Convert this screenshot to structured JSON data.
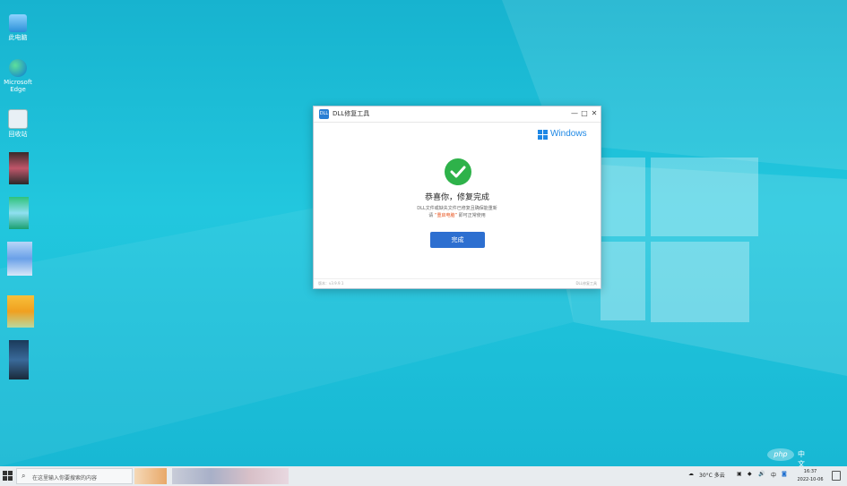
{
  "desktop": {
    "icons": [
      {
        "label": "此电脑",
        "icon": "computer-icon"
      },
      {
        "label": "Microsoft Edge",
        "icon": "edge-icon"
      },
      {
        "label": "回收站",
        "icon": "recycle-bin-icon"
      }
    ]
  },
  "dialog": {
    "title": "DLL修复工具",
    "app_icon_text": "DLL",
    "logo_text": "Windows",
    "headline": "恭喜你，修复完成",
    "line1": "DLL文件或缺失文件已修复且确保能重新",
    "line2_pre": "请",
    "line2_highlight": "“重启电脑”",
    "line2_post": "即可正常使用",
    "done_label": "完成",
    "version": "版本：v3.9.9.1",
    "brand_footer": "DLL修复工具",
    "buttons": {
      "minimize": "—",
      "maximize": "□",
      "close": "✕"
    }
  },
  "taskbar": {
    "search_placeholder": "在这里输入你要搜索的内容",
    "weather": "30°C 多云",
    "ime": "中",
    "time": "16:37",
    "date": "2022-10-06"
  },
  "watermark": {
    "php": "php",
    "cn": "中文网"
  },
  "colors": {
    "accent": "#2d6fd0",
    "success": "#2eb24a",
    "highlight": "#e8541e",
    "desktop": "#22c7de"
  }
}
